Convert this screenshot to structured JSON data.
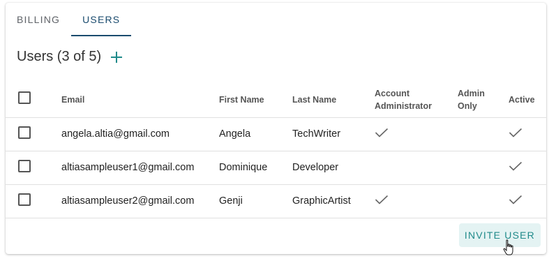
{
  "tabs": [
    {
      "label": "BILLING",
      "active": false
    },
    {
      "label": "USERS",
      "active": true
    }
  ],
  "section": {
    "title": "Users (3 of 5)",
    "add_icon": "plus-icon"
  },
  "table": {
    "headers": {
      "email": "Email",
      "first_name": "First Name",
      "last_name": "Last Name",
      "account_admin_line1": "Account",
      "account_admin_line2": "Administrator",
      "admin_only_line1": "Admin",
      "admin_only_line2": "Only",
      "active": "Active"
    },
    "rows": [
      {
        "email": "angela.altia@gmail.com",
        "first_name": "Angela",
        "last_name": "TechWriter",
        "account_admin": true,
        "admin_only": false,
        "active": true
      },
      {
        "email": "altiasampleuser1@gmail.com",
        "first_name": "Dominique",
        "last_name": "Developer",
        "account_admin": false,
        "admin_only": false,
        "active": true
      },
      {
        "email": "altiasampleuser2@gmail.com",
        "first_name": "Genji",
        "last_name": "GraphicArtist",
        "account_admin": true,
        "admin_only": false,
        "active": true
      }
    ]
  },
  "invite_button": {
    "label": "INVITE USER"
  },
  "colors": {
    "accent": "#1f8a8a",
    "tab_active": "#1a4b6e",
    "invite_bg": "#e4f3f3"
  }
}
